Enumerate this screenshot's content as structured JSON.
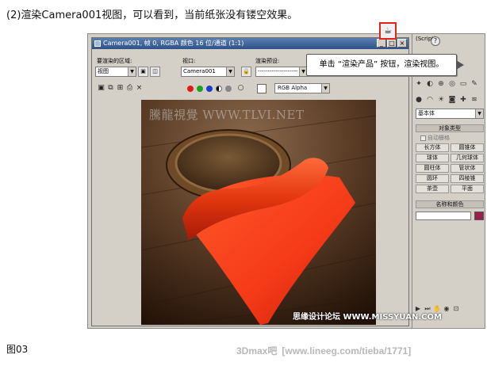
{
  "caption": "(2)渲染Camera001视图，可以看到，当前纸张没有镂空效果。",
  "figure_label": "图03",
  "footer_watermark": {
    "site": "3Dmax吧",
    "url": "[www.lineeg.com/tieba/1771]"
  },
  "render_frame": {
    "title": "Camera001, 帧 0, RGBA 颜色 16 位/通道 (1:1)",
    "area_label": "要渲染的区域:",
    "area_value": "视图",
    "viewport_label": "视口:",
    "viewport_value": "Camera001",
    "preset_label": "渲染预设:",
    "preset_value": "--------------------",
    "channel_value": "RGB Alpha",
    "close_glyph": "×",
    "image_watermark": "騰龍視覺 WWW.TLVI.NET",
    "corner_watermark": "思缘设计论坛 WWW.MISSYUAN.COM"
  },
  "command_panel": {
    "top_label": "(Script)",
    "help_glyph": "?",
    "category_value": "基本体",
    "object_type_header": "对象类型",
    "autogrid_label": "自动栅格",
    "objects": [
      "长方体",
      "圆锥体",
      "球体",
      "几何球体",
      "圆柱体",
      "管状体",
      "圆环",
      "四棱锥",
      "茶壶",
      "平面"
    ],
    "name_color_header": "名称和颜色"
  },
  "callout": {
    "text": "单击 “渲染产品” 按钮，渲染视图。"
  },
  "colors": {
    "accent_red": "#e0261c",
    "title_blue": "#2e5288",
    "panel_gray": "#d4d0c8",
    "object_color": "#9a1f4a"
  },
  "icons": [
    "save-icon",
    "copy-icon",
    "clone-icon",
    "print-icon",
    "clear-icon",
    "red-channel-icon",
    "green-channel-icon",
    "blue-channel-icon",
    "alpha-icon",
    "mono-icon",
    "render-production-icon",
    "help-icon"
  ]
}
